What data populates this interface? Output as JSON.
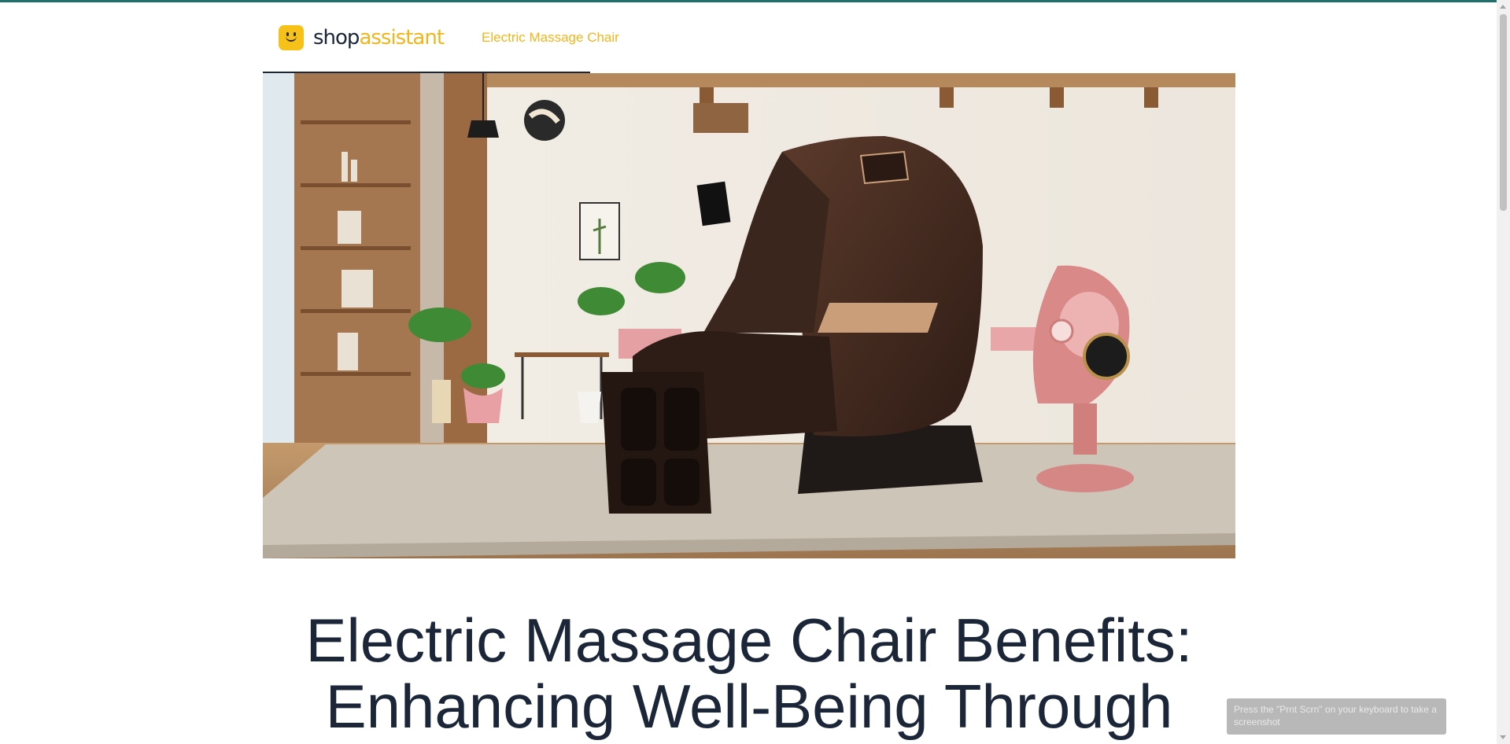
{
  "brand": {
    "name_part1": "shop",
    "name_part2": "assistant"
  },
  "nav": {
    "link": "Electric Massage Chair"
  },
  "hero": {
    "image_label": "Electric massage chair in living room"
  },
  "article": {
    "title": "Electric Massage Chair Benefits: Enhancing Well-Being Through"
  },
  "toast": {
    "text": "Press the \"Prnt Scrn\" on your keyboard to take a screenshot"
  },
  "colors": {
    "brand_yellow": "#f2b51c",
    "navy": "#1b2638",
    "top_accent": "#1f6f6b"
  }
}
